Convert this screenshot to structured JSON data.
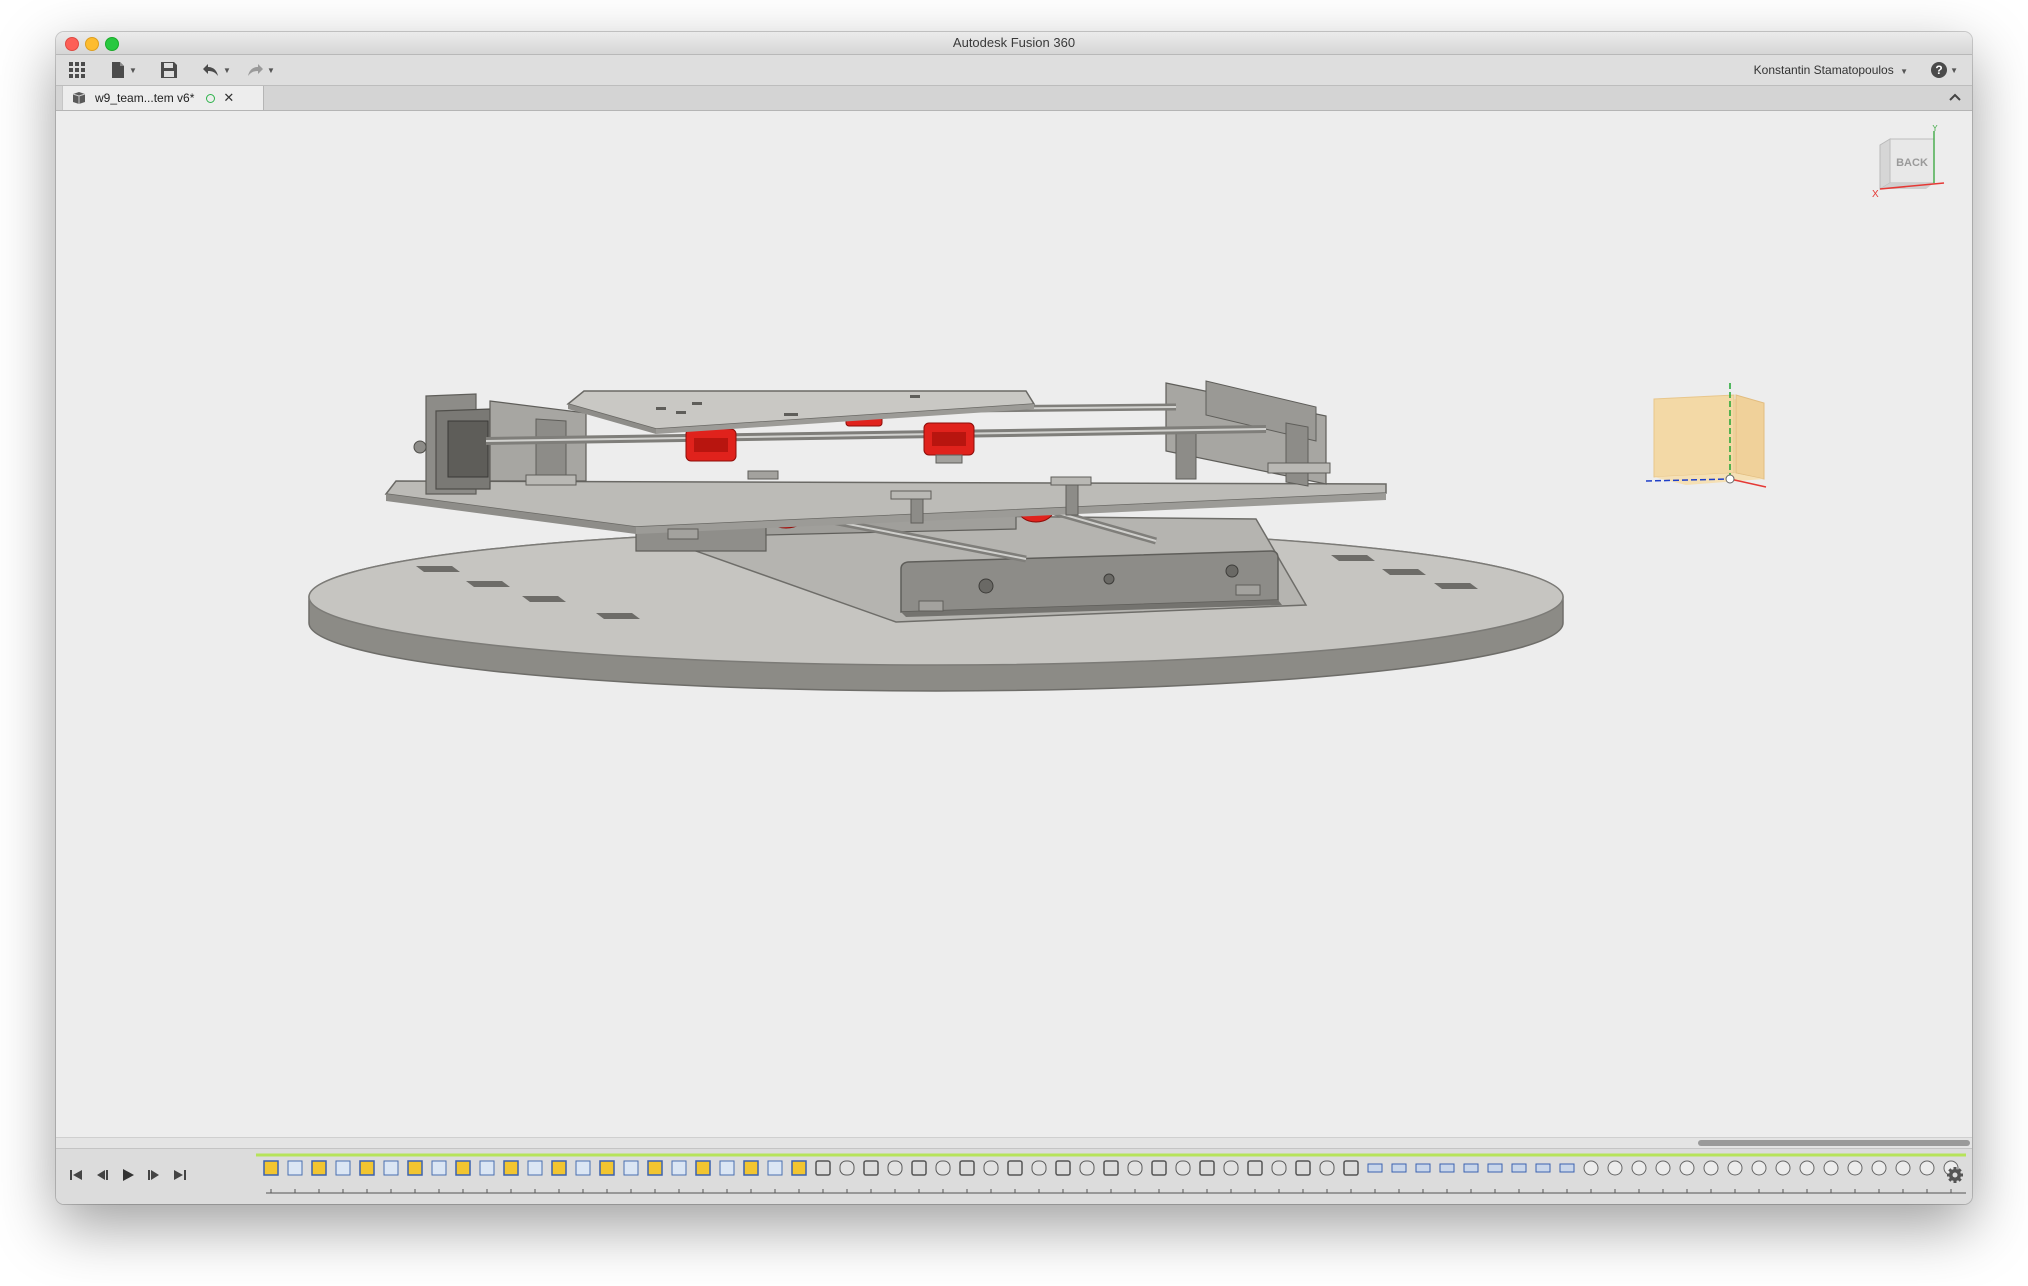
{
  "window": {
    "title": "Autodesk Fusion 360"
  },
  "toolbar": {
    "user_name": "Konstantin Stamatopoulos",
    "help_label": "?"
  },
  "tabs": [
    {
      "label": "w9_team...tem v6*",
      "active": true
    }
  ],
  "viewcube": {
    "face_label": "BACK",
    "axis_x": "X",
    "axis_y": "Y"
  },
  "timeline": {
    "feature_count": 72
  },
  "colors": {
    "accent_red": "#e0221c",
    "part_grey": "#b9b8b4",
    "canvas_bg": "#ededed",
    "origin_box": "#f3d9a6",
    "saved_indicator": "#2db34a"
  },
  "icons": {
    "app_grid": "grid-icon",
    "file": "file-icon",
    "save": "save-icon",
    "undo": "undo-icon",
    "redo": "redo-icon",
    "help": "help-icon",
    "document": "cube-doc-icon",
    "close": "close-icon",
    "collapse": "chevron-up-icon",
    "settings": "gear-icon"
  }
}
